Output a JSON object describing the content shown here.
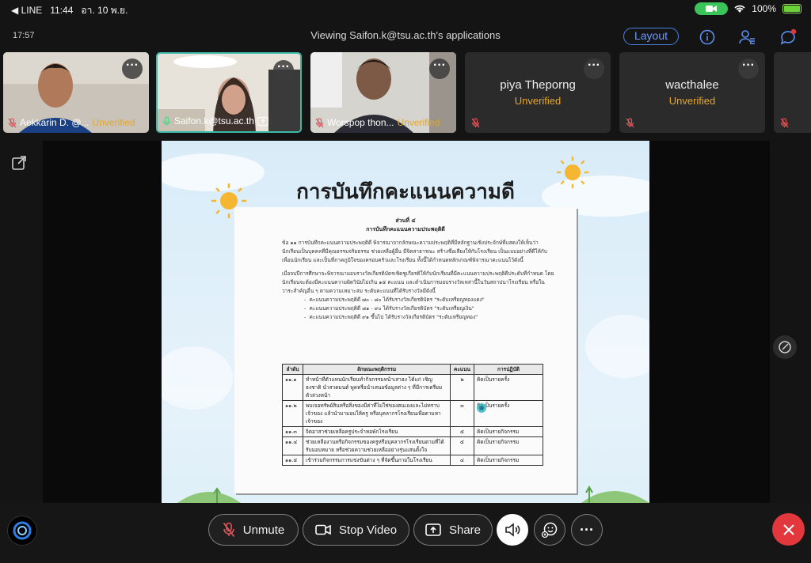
{
  "status_bar": {
    "back_label": "◀ LINE",
    "time": "11:44",
    "date": "อา. 10 พ.ย.",
    "battery": "100%"
  },
  "meeting": {
    "elapsed": "17:57",
    "title": "Viewing Saifon.k@tsu.ac.th's applications",
    "layout_label": "Layout"
  },
  "participants": [
    {
      "name": "Aekkarin D. @...",
      "status": "Unverified"
    },
    {
      "name": "Saifon.k@tsu.ac.th",
      "status": ""
    },
    {
      "name": "Worspop thon...",
      "status": "Unverified"
    },
    {
      "name": "piya Theporng",
      "status": "Unverified"
    },
    {
      "name": "wacthalee",
      "status": "Unverified"
    }
  ],
  "slide": {
    "title": "การบันทึกคะแนนความดี",
    "doc_section": "ส่วนที่ ๔",
    "doc_heading": "การบันทึกคะแนนความประพฤติดี",
    "para1": "ข้อ ๑๑ การบันทึกคะแนนความประพฤติดี พิจารณาจากลักษณะความประพฤติที่มีหลักฐานเชิงประจักษ์ที่แสดงให้เห็นว่านักเรียนเป็นบุคคลที่มีคุณธรรมจริยธรรม ช่วยเหลือผู้อื่น มีจิตสาธารณะ สร้างชื่อเสียงให้กับโรงเรียน เป็นแบบอย่างที่ดีให้กับเพื่อนนักเรียน และเป็นที่ภาคภูมิใจของครอบครัวและโรงเรียน ทั้งนี้ได้กำหนดหลักเกณฑ์พิจารณาคะแนนไว้ดังนี้",
    "para2": "เมื่อจบปีการศึกษาจะพิจารณามอบรางวัลเกียรติบัตรเชิดชูเกียรติให้กับนักเรียนที่มีคะแนนความประพฤติดีประดับที่กำหนด โดยนักเรียนจะต้องมีคะแนนความผิดวินัยไม่เกิน ๑๕ คะแนน และดำเนินการมอบรางวัลเหล่านี้ในวันสถาปนาโรงเรียน หรือในวาระสำคัญอื่น ๆ ตามความเหมาะสม ระดับคะแนนที่ได้รับรางวัลมีดังนี้",
    "bullets": [
      "คะแนนความประพฤติดี ๗๐ - ๘๐ ได้รับรางวัลเกียรติบัตร \"ระดับเหรียญทองแดง\"",
      "คะแนนความประพฤติดี ๘๑ - ๙๐ ได้รับรางวัลเกียรติบัตร \"ระดับเหรียญเงิน\"",
      "คะแนนความประพฤติดี ๙๑ ขึ้นไป ได้รับรางวัลเกียรติบัตร \"ระดับเหรียญทอง\""
    ],
    "table_headers": [
      "ลำดับ",
      "ลักษณะพฤติกรรม",
      "คะแนน",
      "การปฏิบัติ"
    ],
    "table_rows": [
      [
        "๑๑.๑",
        "ทำหน้าที่ตัวแทนนักเรียนทำกิจกรรมหน้าเสาธง ได้แก่ เชิญธงชาติ นำสวดมนต์ พูดหรือนำเสนอข้อมูลต่าง ๆ ที่มีการเตรียมตัวล่วงหน้า",
        "๒",
        "คิดเป็นรายครั้ง"
      ],
      [
        "๑๑.๒",
        "พบเจอทรัพย์สินหรือสิ่งของมีค่าที่ไม่ใช่ของตนเองและไม่ทราบเจ้าของ แล้วนำมามอบให้ครู หรือบุคลากรโรงเรียนเพื่อตามหาเจ้าของ",
        "๓",
        "คิดเป็นรายครั้ง"
      ],
      [
        "๑๑.๓",
        "จิตอาสาช่วยเหลือครูประจำหอพักโรงเรียน",
        "๕",
        "คิดเป็นรายกิจกรรม"
      ],
      [
        "๑๑.๔",
        "ช่วยเหลืองานหรือกิจกรรมของครูหรือบุคลากรโรงเรียนตามที่ได้รับมอบหมาย หรือช่วยความช่วยเหลืออย่างรุ่นแสนตั้งใจ",
        "๕",
        "คิดเป็นรายกิจกรรม"
      ],
      [
        "๑๑.๕",
        "เข้าร่วมกิจกรรมการแข่งขันต่าง ๆ ที่จัดขึ้นภายในโรงเรียน",
        "๔",
        "คิดเป็นรายกิจกรรม"
      ]
    ]
  },
  "controls": {
    "unmute_label": "Unmute",
    "stop_video_label": "Stop Video",
    "share_label": "Share"
  },
  "colors": {
    "accent": "#4a7fe0",
    "unverified": "#e5a72a",
    "active_border": "#3bb9a6",
    "end_call": "#e2373c",
    "mute_red": "#e0555a"
  }
}
